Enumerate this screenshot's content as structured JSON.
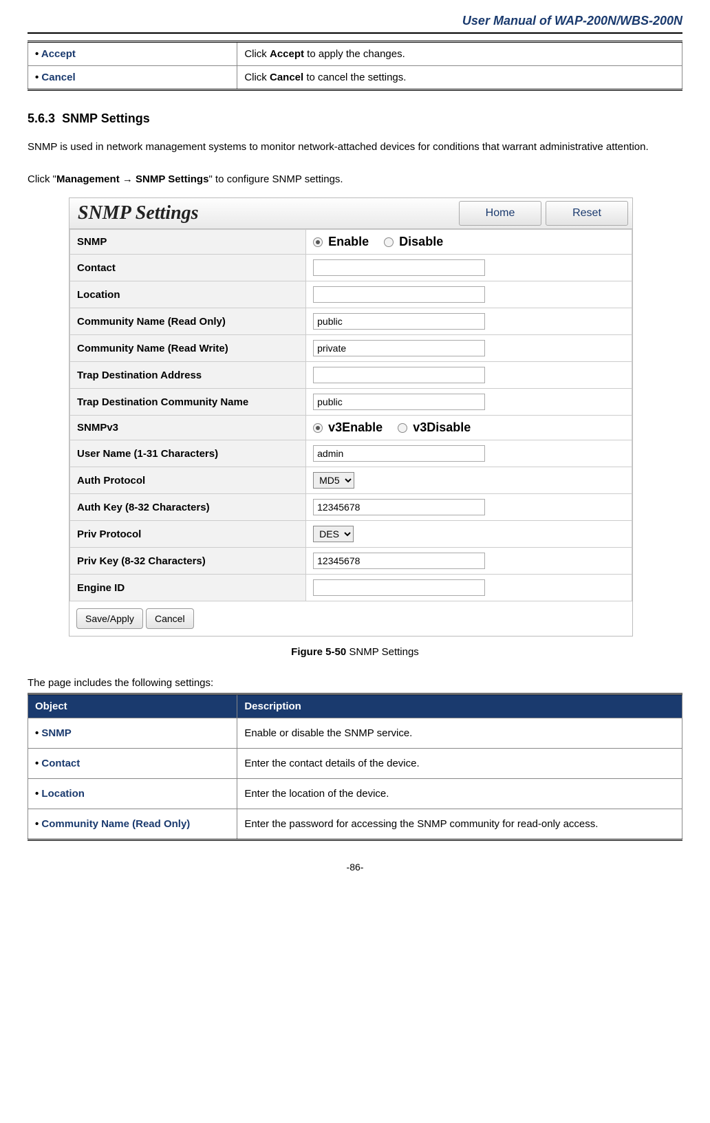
{
  "header": {
    "title": "User Manual of WAP-200N/WBS-200N"
  },
  "top_table": {
    "rows": [
      {
        "object": "Accept",
        "desc_prefix": "Click ",
        "desc_bold": "Accept",
        "desc_suffix": " to apply the changes."
      },
      {
        "object": "Cancel",
        "desc_prefix": "Click ",
        "desc_bold": "Cancel",
        "desc_suffix": " to cancel the settings."
      }
    ]
  },
  "section": {
    "number": "5.6.3",
    "title": "SNMP Settings",
    "intro": "SNMP is used in network management systems to monitor network-attached devices for conditions that warrant administrative attention.",
    "nav_prefix": "Click \"",
    "nav_bold1": "Management",
    "nav_arrow": " → ",
    "nav_bold2": "SNMP Settings",
    "nav_suffix": "\" to configure SNMP settings."
  },
  "figure": {
    "title": "SNMP Settings",
    "home_btn": "Home",
    "reset_btn": "Reset",
    "rows": {
      "snmp_label": "SNMP",
      "snmp_enable": "Enable",
      "snmp_disable": "Disable",
      "contact_label": "Contact",
      "contact_value": "",
      "location_label": "Location",
      "location_value": "",
      "comm_ro_label": "Community Name (Read Only)",
      "comm_ro_value": "public",
      "comm_rw_label": "Community Name (Read Write)",
      "comm_rw_value": "private",
      "trap_addr_label": "Trap Destination Address",
      "trap_addr_value": "",
      "trap_comm_label": "Trap Destination Community Name",
      "trap_comm_value": "public",
      "snmpv3_label": "SNMPv3",
      "v3enable": "v3Enable",
      "v3disable": "v3Disable",
      "username_label": "User Name (1-31 Characters)",
      "username_value": "admin",
      "authproto_label": "Auth Protocol",
      "authproto_value": "MD5",
      "authkey_label": "Auth Key (8-32 Characters)",
      "authkey_value": "12345678",
      "privproto_label": "Priv Protocol",
      "privproto_value": "DES",
      "privkey_label": "Priv Key (8-32 Characters)",
      "privkey_value": "12345678",
      "engine_label": "Engine ID",
      "engine_value": ""
    },
    "save_btn": "Save/Apply",
    "cancel_btn": "Cancel",
    "caption_bold": "Figure 5-50",
    "caption_text": " SNMP Settings"
  },
  "desc_intro": "The page includes the following settings:",
  "desc_table": {
    "header_obj": "Object",
    "header_desc": "Description",
    "rows": [
      {
        "object": "SNMP",
        "desc": "Enable or disable the SNMP service."
      },
      {
        "object": "Contact",
        "desc": "Enter the contact details of the device."
      },
      {
        "object": "Location",
        "desc": "Enter the location of the device."
      },
      {
        "object": "Community Name (Read Only)",
        "desc": "Enter the password for accessing the SNMP community for read-only access."
      }
    ]
  },
  "page_number": "-86-"
}
